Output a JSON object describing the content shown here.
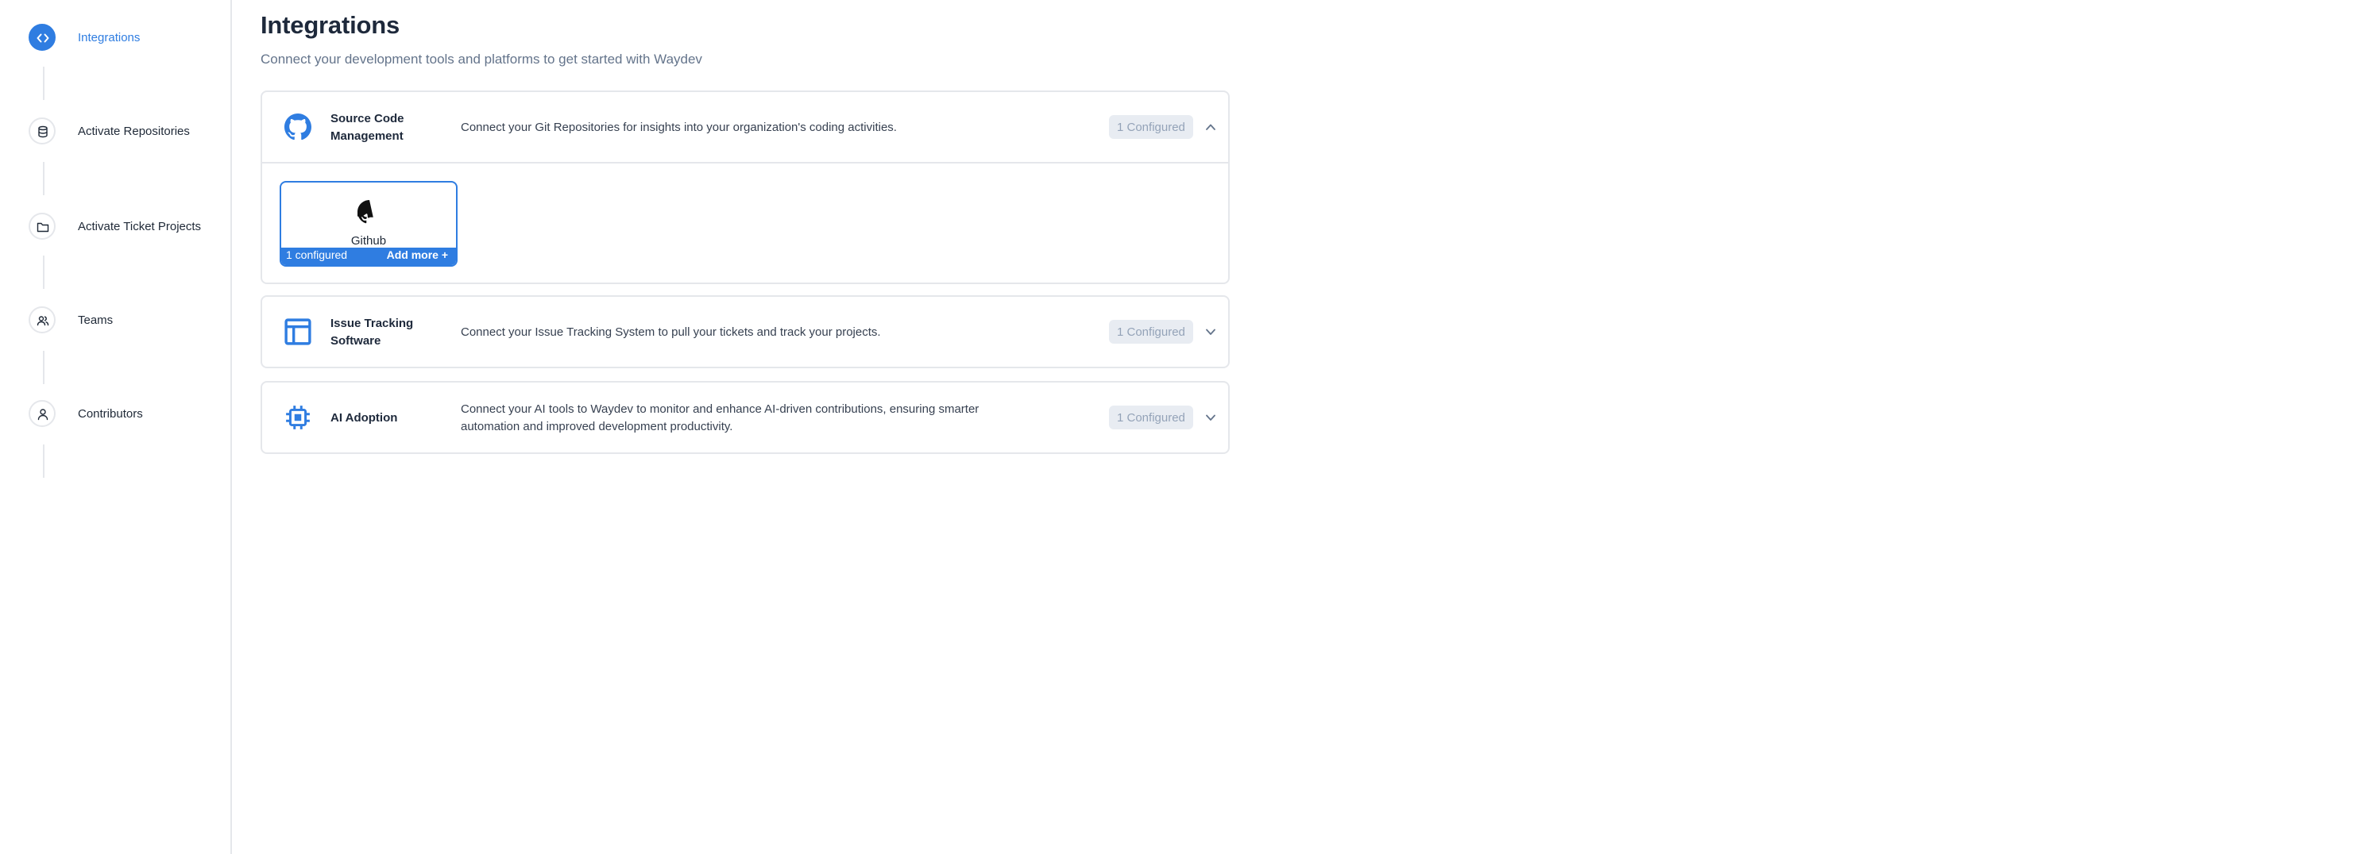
{
  "sidebar": {
    "steps": [
      {
        "label": "Integrations",
        "icon": "code-icon",
        "active": true
      },
      {
        "label": "Activate Repositories",
        "icon": "database-icon",
        "active": false
      },
      {
        "label": "Activate Ticket Projects",
        "icon": "folder-icon",
        "active": false
      },
      {
        "label": "Teams",
        "icon": "users-icon",
        "active": false
      },
      {
        "label": "Contributors",
        "icon": "user-icon",
        "active": false
      }
    ]
  },
  "main": {
    "title": "Integrations",
    "subtitle": "Connect your development tools and platforms to get started with Waydev"
  },
  "cards": [
    {
      "title": "Source Code Management",
      "description": "Connect your Git Repositories for insights into your organization's coding activities.",
      "badge": "1 Configured",
      "icon": "github-icon",
      "expanded": true,
      "tiles": [
        {
          "name": "Github",
          "count_label": "1 configured",
          "add_label": "Add more +",
          "icon": "github-icon"
        }
      ]
    },
    {
      "title": "Issue Tracking Software",
      "description": "Connect your Issue Tracking System to pull your tickets and track your projects.",
      "badge": "1 Configured",
      "icon": "layout-icon",
      "expanded": false
    },
    {
      "title": "AI Adoption",
      "description": "Connect your AI tools to Waydev to monitor and enhance AI-driven contributions, ensuring smarter automation and improved development productivity.",
      "badge": "1 Configured",
      "icon": "chip-icon",
      "expanded": false
    }
  ],
  "colors": {
    "accent": "#2f7de1",
    "badge_bg": "#e8ecf2",
    "badge_text": "#94a3b8",
    "border": "#e5e7eb"
  }
}
